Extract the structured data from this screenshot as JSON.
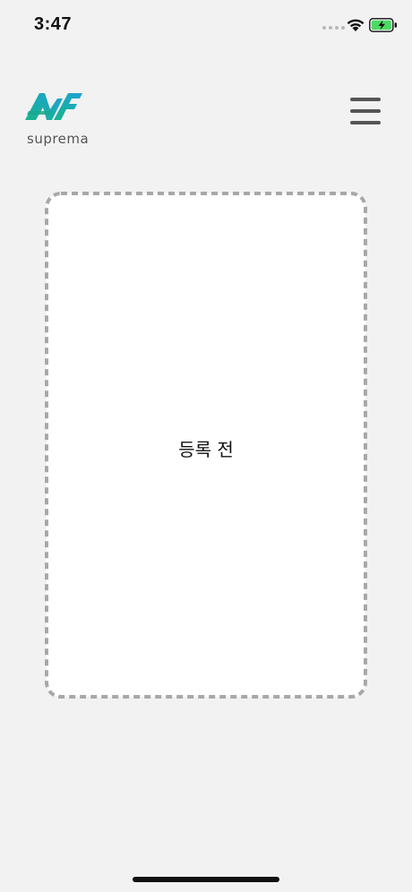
{
  "status_bar": {
    "time": "3:47",
    "battery_charging": true,
    "battery_color": "#4cd964"
  },
  "header": {
    "logo_text": "suprema",
    "logo_mark": "AF",
    "logo_colors": [
      "#1fb58f",
      "#1e9fd6"
    ],
    "menu_icon": "hamburger-menu-icon"
  },
  "card": {
    "status_text": "등록 전",
    "border_color": "#a8a8a8",
    "border_style": "dashed"
  }
}
